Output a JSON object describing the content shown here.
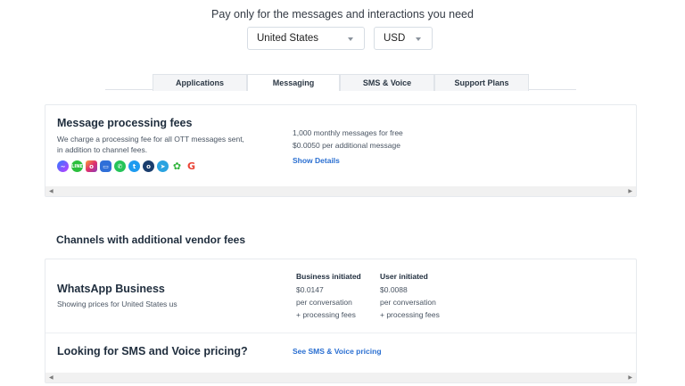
{
  "header": {
    "subtitle": "Pay only for the messages and interactions you need",
    "country_select": "United States",
    "currency_select": "USD"
  },
  "tabs": [
    {
      "label": "Applications",
      "active": false
    },
    {
      "label": "Messaging",
      "active": true
    },
    {
      "label": "SMS & Voice",
      "active": false
    },
    {
      "label": "Support Plans",
      "active": false
    }
  ],
  "processing_fees": {
    "title": "Message processing fees",
    "description_line1": "We charge a processing fee for all OTT messages sent,",
    "description_line2": "in addition to channel fees.",
    "free_line": "1,000 monthly messages for free",
    "additional_line": "$0.0050 per additional message",
    "details_link": "Show Details",
    "channel_icons": [
      "messenger-icon",
      "line-icon",
      "instagram-icon",
      "viber-icon",
      "whatsapp-icon",
      "twitter-icon",
      "signal-icon",
      "telegram-icon",
      "wechat-icon",
      "google-icon"
    ]
  },
  "vendor_section": {
    "heading": "Channels with additional vendor fees"
  },
  "whatsapp": {
    "title": "WhatsApp Business",
    "subtitle": "Showing prices for United States us",
    "business": {
      "header": "Business initiated",
      "price": "$0.0147",
      "unit": "per conversation",
      "extra": "+ processing fees"
    },
    "user": {
      "header": "User initiated",
      "price": "$0.0088",
      "unit": "per conversation",
      "extra": "+ processing fees"
    }
  },
  "sms_voice": {
    "title": "Looking for SMS and Voice pricing?",
    "link": "See SMS & Voice pricing"
  },
  "colors": {
    "link": "#2a6fd1",
    "text": "#1f2d3d",
    "muted": "#4a5563"
  }
}
